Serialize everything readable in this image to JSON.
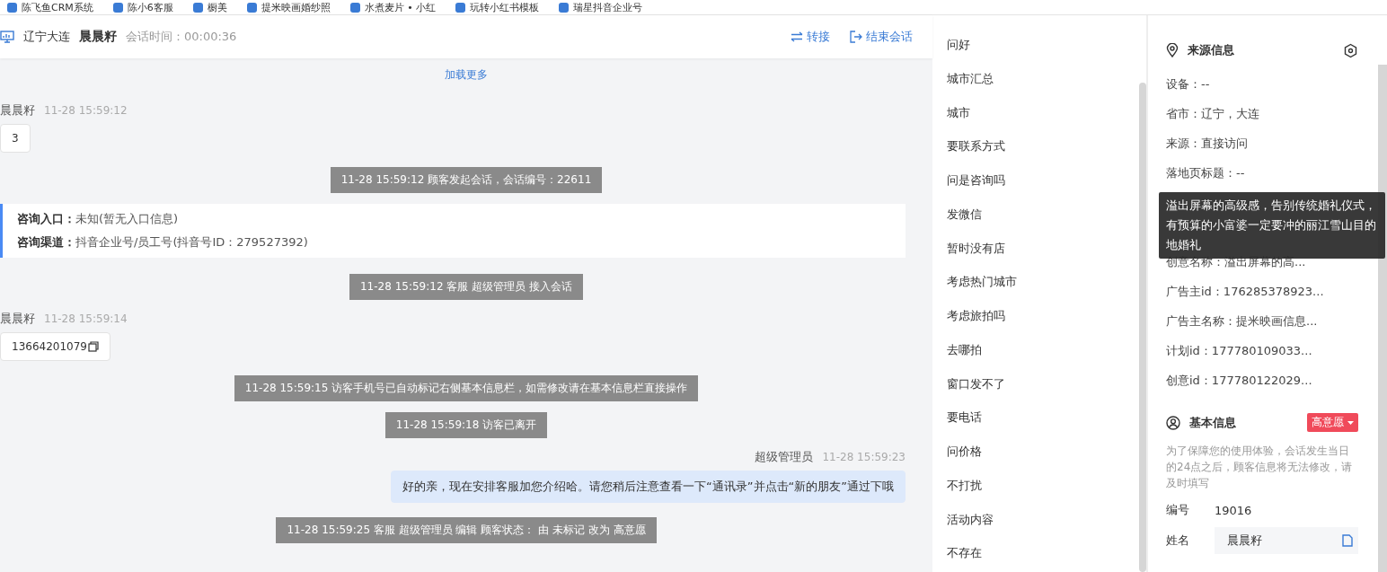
{
  "bookmarks": [
    {
      "label": "陈飞鱼CRM系统"
    },
    {
      "label": "陈小6客服"
    },
    {
      "label": "橱美"
    },
    {
      "label": "提米映画婚纱照"
    },
    {
      "label": "水煮麦片 • 小红"
    },
    {
      "label": "玩转小红书模板"
    },
    {
      "label": "瑞星抖音企业号"
    }
  ],
  "header": {
    "location": "辽宁大连",
    "visitor": "晨晨籽",
    "session_time": "会话时间：00:00:36",
    "actions": [
      {
        "kind": "transfer",
        "label": "转接"
      },
      {
        "kind": "end",
        "label": "结束会话"
      }
    ]
  },
  "chat": {
    "load_more": "加载更多",
    "messages": [
      {
        "kind": "visitor",
        "name": "晨晨籽",
        "time": "11-28 15:59:12",
        "text": "3",
        "copyable": false
      },
      {
        "kind": "system",
        "text": "11-28 15:59:12 顾客发起会话，会话编号：22611"
      },
      {
        "kind": "info",
        "rows": [
          {
            "label": "咨询入口：",
            "value": "未知(暂无入口信息)"
          },
          {
            "label": "咨询渠道：",
            "value": "抖音企业号/员工号(抖音号ID：279527392)"
          }
        ]
      },
      {
        "kind": "system",
        "text": "11-28 15:59:12 客服 超级管理员 接入会话"
      },
      {
        "kind": "visitor",
        "name": "晨晨籽",
        "time": "11-28 15:59:14",
        "text": "13664201079",
        "copyable": true
      },
      {
        "kind": "system",
        "text": "11-28 15:59:15 访客手机号已自动标记右侧基本信息栏，如需修改请在基本信息栏直接操作"
      },
      {
        "kind": "system",
        "text": "11-28 15:59:18 访客已离开"
      },
      {
        "kind": "agent",
        "name": "超级管理员",
        "time": "11-28 15:59:23",
        "text": "好的亲，现在安排客服加您介绍哈。请您稍后注意查看一下“通讯录”并点击“新的朋友”通过下哦"
      },
      {
        "kind": "system",
        "text": "11-28 15:59:25 客服 超级管理员 编辑 顾客状态： 由 未标记 改为 高意愿"
      }
    ]
  },
  "quick_replies": [
    "问好",
    "城市汇总",
    "城市",
    "要联系方式",
    "问是咨询吗",
    "发微信",
    "暂时没有店",
    "考虑热门城市",
    "考虑旅拍吗",
    "去哪拍",
    "窗口发不了",
    "要电话",
    "问价格",
    "不打扰",
    "活动内容",
    "不存在"
  ],
  "source_info": {
    "title": "来源信息",
    "fields": [
      {
        "kind": "field",
        "text": "设备：--"
      },
      {
        "kind": "field",
        "text": "省市：辽宁，大连"
      },
      {
        "kind": "field",
        "text": "来源：直接访问"
      },
      {
        "kind": "field",
        "text": "落地页标题：--"
      },
      {
        "kind": "hidden"
      },
      {
        "kind": "hidden"
      },
      {
        "kind": "field",
        "text": "创意名称：溢出屏幕的高..."
      },
      {
        "kind": "field",
        "text": "广告主id：176285378923..."
      },
      {
        "kind": "field",
        "text": "广告主名称：提米映画信息..."
      },
      {
        "kind": "field",
        "text": "计划id：177780109033..."
      },
      {
        "kind": "field",
        "text": "创意id：177780122029..."
      }
    ],
    "tooltip": "溢出屏幕的高级感，告别传统婚礼仪式，有预算的小富婆一定要冲的丽江雪山目的地婚礼"
  },
  "basic_info": {
    "title": "基本信息",
    "status": "高意愿",
    "note": "为了保障您的使用体验，会话发生当日的24点之后，顾客信息将无法修改，请及时填写",
    "fields": [
      {
        "kind": "text",
        "label": "编号",
        "value": "19016"
      },
      {
        "kind": "input",
        "label": "姓名",
        "value": "晨晨籽"
      }
    ]
  }
}
